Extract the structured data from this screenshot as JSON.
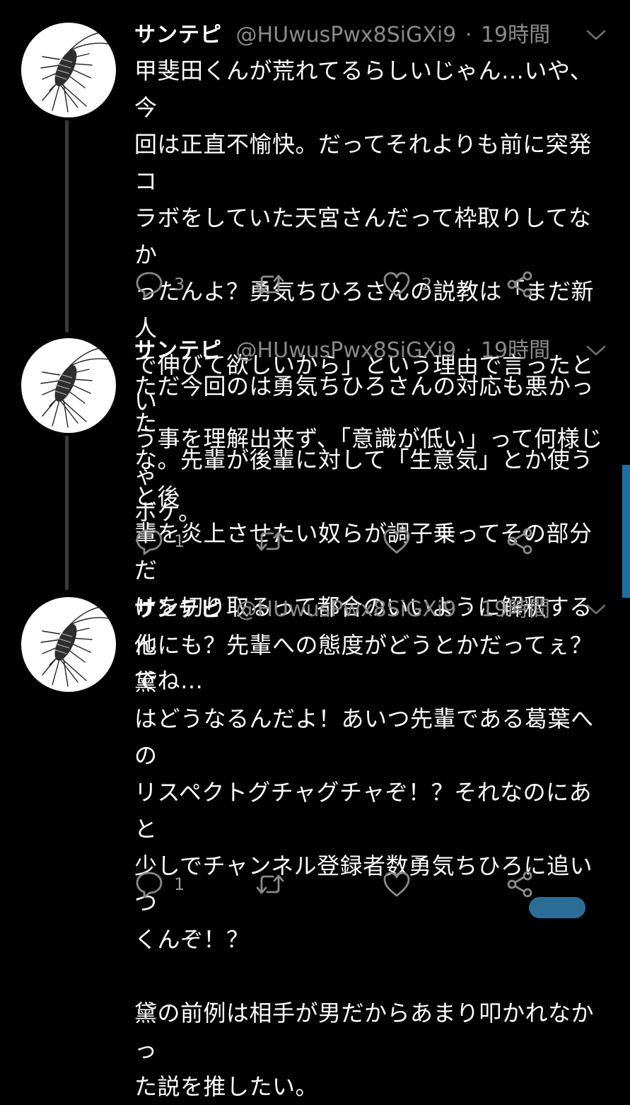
{
  "tweets": [
    {
      "display_name": "サンテピ",
      "handle": "@HUwusPwx8SiGXi9",
      "separator": "·",
      "time": "19時間",
      "lines": [
        "甲斐田くんが荒れてるらしいじゃん…いや、今",
        "回は正直不愉快。だってそれよりも前に突発コ",
        "ラボをしていた天宮さんだって枠取りしてなか",
        "ったんよ？勇気ちひろさんの説教は「まだ新人",
        "で伸びて欲しいから」という理由で言ったとい",
        "う事を理解出来ず、「意識が低い」って何様じゃ",
        "ボケ。"
      ],
      "reply_count": "3",
      "retweet_count": "",
      "like_count": "2"
    },
    {
      "display_name": "サンテピ",
      "handle": "@HUwusPwx8SiGXi9",
      "separator": "·",
      "time": "19時間",
      "lines": [
        "ただ今回のは勇気ちひろさんの対応も悪かった",
        "な。先輩が後輩に対して「生意気」とか使うと後",
        "輩を炎上させたい奴らが調子乗ってその部分だ",
        "けを切り取るって都合のいいように解釈するん",
        "でね…"
      ],
      "reply_count": "1",
      "retweet_count": "",
      "like_count": ""
    },
    {
      "display_name": "サンテピ",
      "handle": "@HUwusPwx8SiGXi9",
      "separator": "·",
      "time": "19時間",
      "lines": [
        "他にも？先輩への態度がどうとかだってぇ？黛",
        "はどうなるんだよ！あいつ先輩である葛葉への",
        "リスペクトグチャグチャぞ！？それなのにあと",
        "少しでチャンネル登録者数勇気ちひろに追いつ",
        "くんぞ！？",
        "",
        "黛の前例は相手が男だからあまり叩かれなかっ",
        "た説を推したい。"
      ],
      "reply_count": "1",
      "retweet_count": "",
      "like_count": ""
    }
  ],
  "icons": {
    "avatar": "silverfish-avatar-icon",
    "caret": "chevron-down-icon",
    "reply": "reply-icon",
    "retweet": "retweet-icon",
    "like": "heart-icon",
    "share": "share-icon"
  },
  "colors": {
    "background": "#000000",
    "text": "#ffffff",
    "muted": "#8a8a8a",
    "thread_line": "#3a3a3a",
    "accent": "#1d6fa5"
  }
}
